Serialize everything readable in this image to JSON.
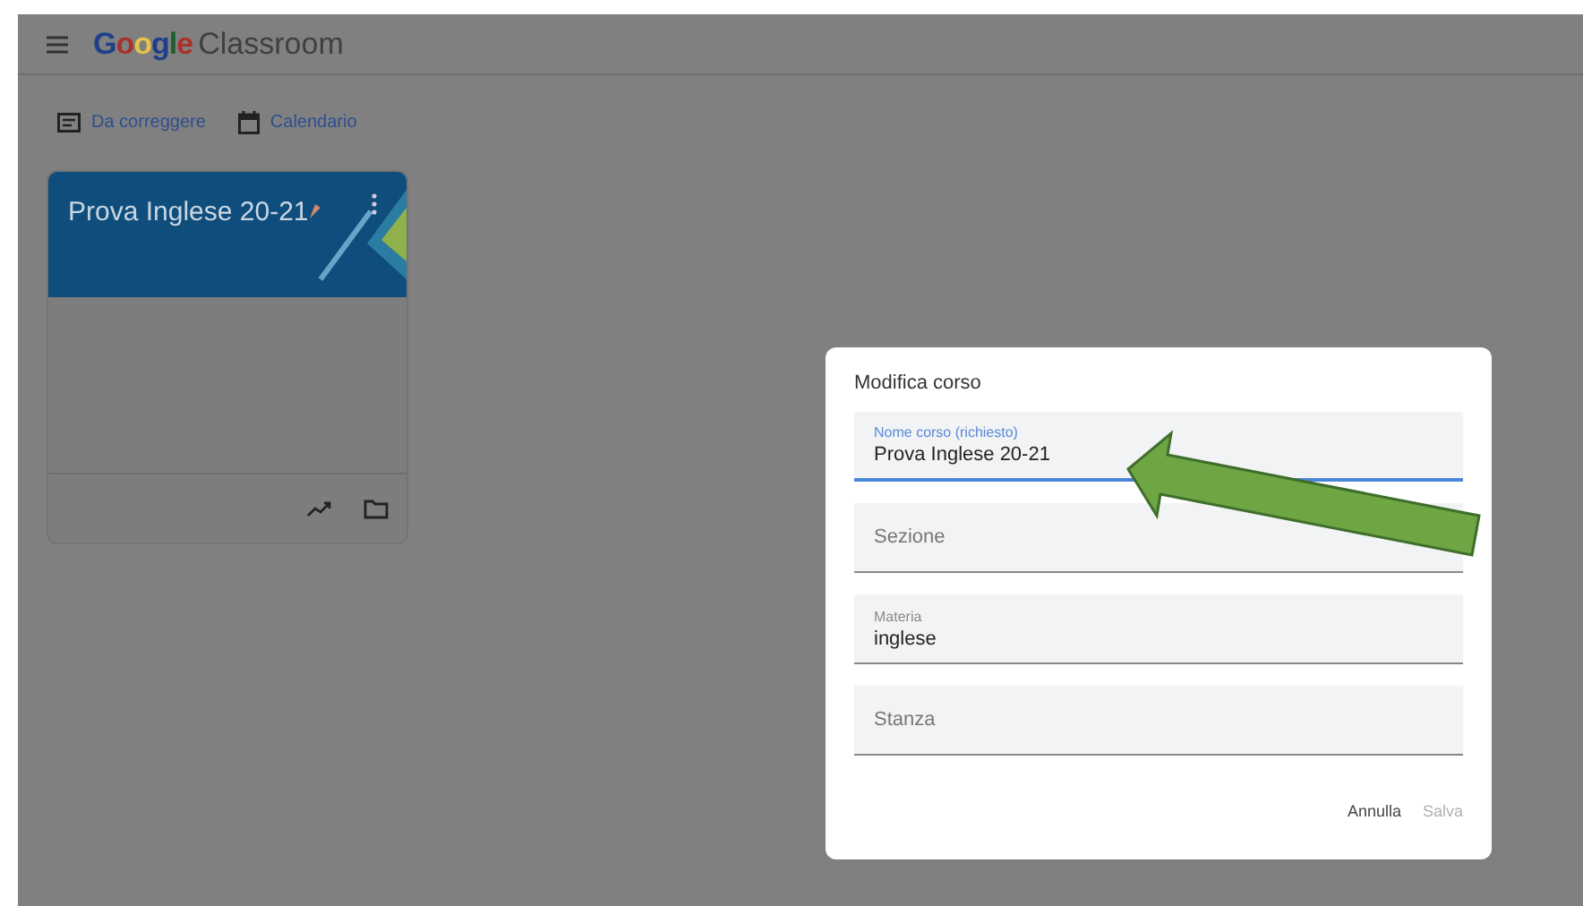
{
  "header": {
    "logo_word": "Google",
    "product": "Classroom"
  },
  "nav_links": [
    {
      "kind": "todo",
      "label": "Da correggere"
    },
    {
      "kind": "calendar",
      "label": "Calendario"
    }
  ],
  "course_card": {
    "title": "Prova Inglese 20-21"
  },
  "dialog": {
    "title": "Modifica corso",
    "fields": [
      {
        "label": "Nome corso (richiesto)",
        "value": "Prova Inglese 20-21",
        "focused": true
      },
      {
        "placeholder": "Sezione",
        "focused": false
      },
      {
        "label": "Materia",
        "value": "inglese",
        "focused": false
      },
      {
        "placeholder": "Stanza",
        "focused": false
      }
    ],
    "buttons": [
      {
        "label": "Annulla",
        "disabled": false
      },
      {
        "label": "Salva",
        "disabled": true
      }
    ]
  }
}
